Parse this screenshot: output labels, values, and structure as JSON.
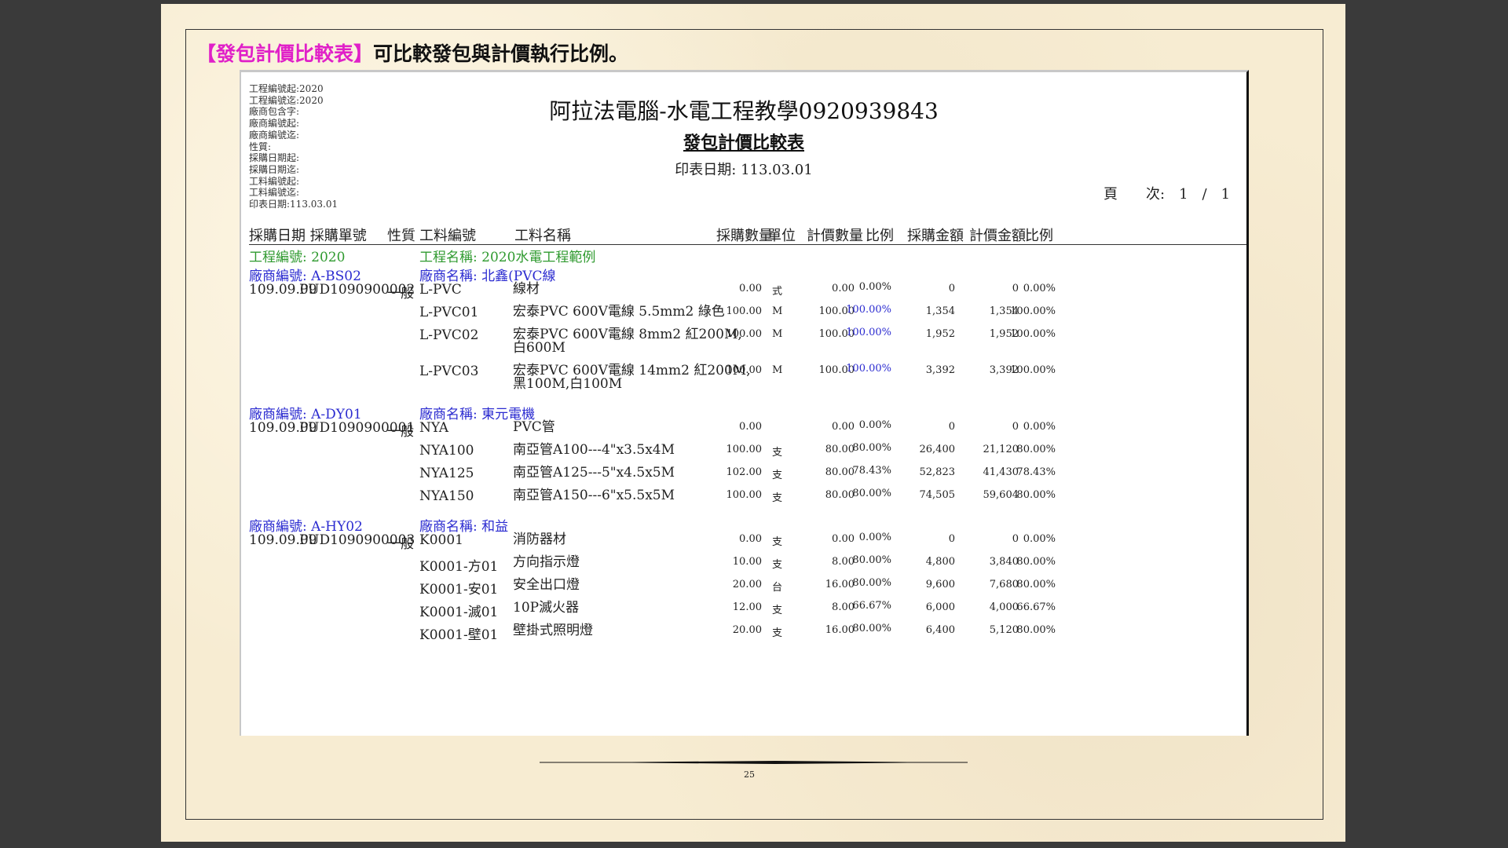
{
  "heading": {
    "highlight": "【發包計價比較表】",
    "rest": "可比較發包與計價執行比例。"
  },
  "report": {
    "params": [
      "工程編號起:2020",
      "工程編號迄:2020",
      "廠商包含字:",
      "廠商編號起:",
      "廠商編號迄:",
      "性質:",
      "採購日期起:",
      "採購日期迄:",
      "工料編號起:",
      "工料編號迄:",
      "印表日期:113.03.01"
    ],
    "company": "阿拉法電腦-水電工程教學0920939843",
    "subtitle": "發包計價比較表",
    "print_date": "印表日期: 113.03.01",
    "page_info": "頁　　次:　1　/　1",
    "headers": {
      "date_po": "採購日期 採購單號",
      "type": "性質",
      "code": "工料編號",
      "name": "工料名稱",
      "qty": "採購數量",
      "unit": "單位",
      "bill_qty": "計價數量",
      "ratio1": "比例",
      "amount": "採購金額",
      "bill_amount": "計價金額",
      "ratio2": "比例"
    },
    "project": {
      "code_label": "工程編號: 2020",
      "name_label": "工程名稱: 2020水電工程範例"
    },
    "vendors": [
      {
        "code_label": "廠商編號: A-BS02",
        "name_label": "廠商名稱: 北鑫(PVC線",
        "rows": [
          {
            "date": "109.09.09",
            "po": "PUD1090900002",
            "type": "一般",
            "code": "L-PVC",
            "name": [
              "線材"
            ],
            "qty": "0.00",
            "unit": "式",
            "bill_qty": "0.00",
            "ratio1": "0.00%",
            "ratio1_blue": false,
            "amount": "0",
            "bill_amount": "0",
            "ratio2": "0.00%"
          },
          {
            "code": "L-PVC01",
            "name": [
              "宏泰PVC 600V電線 5.5mm2 綠色"
            ],
            "qty": "100.00",
            "unit": "M",
            "bill_qty": "100.00",
            "ratio1": "100.00%",
            "ratio1_blue": true,
            "amount": "1,354",
            "bill_amount": "1,354",
            "ratio2": "100.00%"
          },
          {
            "code": "L-PVC02",
            "name": [
              "宏泰PVC 600V電線 8mm2 紅200M,",
              "白600M"
            ],
            "qty": "100.00",
            "unit": "M",
            "bill_qty": "100.00",
            "ratio1": "100.00%",
            "ratio1_blue": true,
            "amount": "1,952",
            "bill_amount": "1,952",
            "ratio2": "100.00%"
          },
          {
            "code": "L-PVC03",
            "name": [
              "宏泰PVC 600V電線 14mm2 紅200M,",
              "黑100M,白100M"
            ],
            "qty": "100.00",
            "unit": "M",
            "bill_qty": "100.00",
            "ratio1": "100.00%",
            "ratio1_blue": true,
            "amount": "3,392",
            "bill_amount": "3,392",
            "ratio2": "100.00%"
          }
        ]
      },
      {
        "code_label": "廠商編號: A-DY01",
        "name_label": "廠商名稱: 東元電機",
        "rows": [
          {
            "date": "109.09.09",
            "po": "PUD1090900001",
            "type": "一般",
            "code": "NYA",
            "name": [
              "PVC管"
            ],
            "qty": "0.00",
            "unit": "",
            "bill_qty": "0.00",
            "ratio1": "0.00%",
            "ratio1_blue": false,
            "amount": "0",
            "bill_amount": "0",
            "ratio2": "0.00%"
          },
          {
            "code": "NYA100",
            "name": [
              "南亞管A100---4\"x3.5x4M"
            ],
            "qty": "100.00",
            "unit": "支",
            "bill_qty": "80.00",
            "ratio1": "80.00%",
            "ratio1_blue": false,
            "amount": "26,400",
            "bill_amount": "21,120",
            "ratio2": "80.00%"
          },
          {
            "code": "NYA125",
            "name": [
              "南亞管A125---5\"x4.5x5M"
            ],
            "qty": "102.00",
            "unit": "支",
            "bill_qty": "80.00",
            "ratio1": "78.43%",
            "ratio1_blue": false,
            "amount": "52,823",
            "bill_amount": "41,430",
            "ratio2": "78.43%"
          },
          {
            "code": "NYA150",
            "name": [
              "南亞管A150---6\"x5.5x5M"
            ],
            "qty": "100.00",
            "unit": "支",
            "bill_qty": "80.00",
            "ratio1": "80.00%",
            "ratio1_blue": false,
            "amount": "74,505",
            "bill_amount": "59,604",
            "ratio2": "80.00%"
          }
        ]
      },
      {
        "code_label": "廠商編號: A-HY02",
        "name_label": "廠商名稱: 和益",
        "rows": [
          {
            "date": "109.09.09",
            "po": "PUD1090900003",
            "type": "一般",
            "code": "K0001",
            "name": [
              "消防器材"
            ],
            "qty": "0.00",
            "unit": "支",
            "bill_qty": "0.00",
            "ratio1": "0.00%",
            "ratio1_blue": false,
            "amount": "0",
            "bill_amount": "0",
            "ratio2": "0.00%"
          },
          {
            "code": "K0001-方01",
            "name": [
              "方向指示燈"
            ],
            "qty": "10.00",
            "unit": "支",
            "bill_qty": "8.00",
            "ratio1": "80.00%",
            "ratio1_blue": false,
            "amount": "4,800",
            "bill_amount": "3,840",
            "ratio2": "80.00%"
          },
          {
            "code": "K0001-安01",
            "name": [
              "安全出口燈"
            ],
            "qty": "20.00",
            "unit": "台",
            "bill_qty": "16.00",
            "ratio1": "80.00%",
            "ratio1_blue": false,
            "amount": "9,600",
            "bill_amount": "7,680",
            "ratio2": "80.00%"
          },
          {
            "code": "K0001-滅01",
            "name": [
              "10P滅火器"
            ],
            "qty": "12.00",
            "unit": "支",
            "bill_qty": "8.00",
            "ratio1": "66.67%",
            "ratio1_blue": false,
            "amount": "6,000",
            "bill_amount": "4,000",
            "ratio2": "66.67%"
          },
          {
            "code": "K0001-壁01",
            "name": [
              "壁掛式照明燈"
            ],
            "qty": "20.00",
            "unit": "支",
            "bill_qty": "16.00",
            "ratio1": "80.00%",
            "ratio1_blue": false,
            "amount": "6,400",
            "bill_amount": "5,120",
            "ratio2": "80.00%"
          }
        ]
      }
    ]
  },
  "page_number": "25"
}
